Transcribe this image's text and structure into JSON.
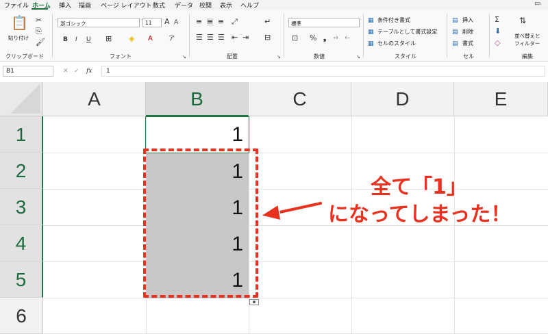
{
  "menu": {
    "tabs": [
      "ファイル",
      "ホーム",
      "挿入",
      "描画",
      "ページ レイアウト",
      "数式",
      "データ",
      "校閲",
      "表示",
      "ヘルプ"
    ],
    "active_tab": "ホーム"
  },
  "ribbon": {
    "clipboard": {
      "paste_label": "貼り付け",
      "group_label": "クリップボード"
    },
    "font": {
      "font_name": "游ゴシック",
      "font_size": "11",
      "group_label": "フォント"
    },
    "alignment": {
      "group_label": "配置"
    },
    "number": {
      "format": "標準",
      "group_label": "数値"
    },
    "styles": {
      "conditional": "条件付き書式",
      "table": "テーブルとして書式設定",
      "cell_style": "セルのスタイル",
      "group_label": "スタイル"
    },
    "cells": {
      "insert": "挿入",
      "delete": "削除",
      "format": "書式",
      "group_label": "セル"
    },
    "editing": {
      "sort_label_1": "並べ替えと",
      "sort_label_2": "フィルター",
      "group_label": "編集"
    }
  },
  "formula_bar": {
    "name_box": "B1",
    "fx": "fx",
    "content": "1"
  },
  "grid": {
    "columns": [
      "A",
      "B",
      "C",
      "D",
      "E"
    ],
    "selected_column": "B",
    "rows": [
      "1",
      "2",
      "3",
      "4",
      "5",
      "6"
    ],
    "cells_b": [
      "1",
      "1",
      "1",
      "1",
      "1"
    ]
  },
  "annotation": {
    "line1": "全て「1」",
    "line2": "になってしまった！",
    "color": "#e8321f"
  }
}
